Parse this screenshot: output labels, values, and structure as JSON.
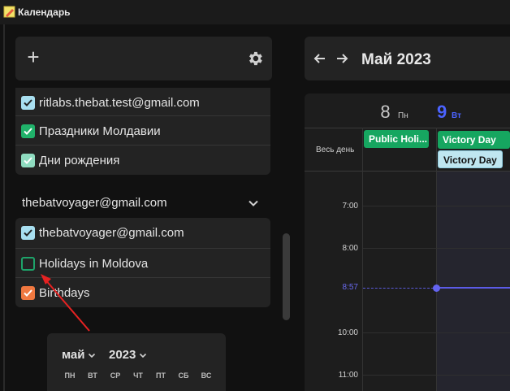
{
  "window": {
    "title": "Календарь",
    "app_icon": "notepad-pencil-icon"
  },
  "sidebar": {
    "add_icon": "+",
    "settings_icon": "gear-icon",
    "calendars_group1": [
      {
        "label": "ritlabs.thebat.test@gmail.com",
        "checked": true,
        "color": "#a8dff0"
      },
      {
        "label": "Праздники Молдавии",
        "checked": true,
        "color": "#20b26a"
      },
      {
        "label": "Дни рождения",
        "checked": true,
        "color": "#8fdcc0"
      }
    ],
    "account": {
      "name": "thebatvoyager@gmail.com",
      "expanded": true
    },
    "calendars_group2": [
      {
        "label": "thebatvoyager@gmail.com",
        "checked": true,
        "color": "#a8dff0"
      },
      {
        "label": "Holidays in Moldova",
        "checked": false,
        "color": "#1ea36a"
      },
      {
        "label": "Birthdays",
        "checked": true,
        "color": "#f07840"
      }
    ]
  },
  "mini_calendar": {
    "month": "май",
    "year": "2023",
    "weekdays": [
      "ПН",
      "ВТ",
      "СР",
      "ЧТ",
      "ПТ",
      "СБ",
      "ВС"
    ]
  },
  "header": {
    "title": "Май 2023",
    "prev_icon": "arrow-left-icon",
    "next_icon": "arrow-right-icon"
  },
  "week_view": {
    "days": [
      {
        "num": "8",
        "name": "Пн",
        "today": false
      },
      {
        "num": "9",
        "name": "Вт",
        "today": true
      }
    ],
    "all_day_label": "Весь день",
    "events": [
      {
        "title": "Public Holi...",
        "day": 0,
        "color": "#16a660"
      },
      {
        "title": "Victory Day",
        "day": 1,
        "color": "#16a660"
      },
      {
        "title": "Victory Day",
        "day": 1,
        "color": "#bfe6f0"
      }
    ],
    "times": [
      "7:00",
      "8:00",
      "8:57",
      "10:00",
      "11:00"
    ],
    "current_time": "8:57",
    "today_color": "#4b63ff",
    "now_color": "#5b5be6"
  }
}
